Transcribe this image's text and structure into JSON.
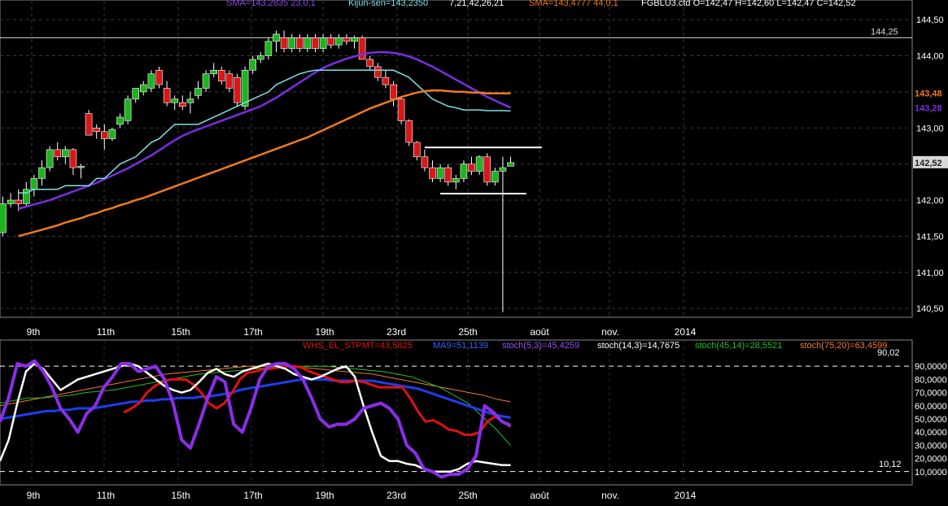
{
  "header": {
    "sma_short": "SMA=143,2835  23,0,1",
    "kijun": "Kijun-sen=143,2350",
    "ichimoku_params": "7,21,42,26,21",
    "sma_long": "SMA=143,4777  44,0,1",
    "ohlc": "FGBLU3.ctd O=142,47 H=142,60 L=142,47 C=142,52"
  },
  "price_axis": {
    "ticks": [
      "144,50",
      "144,00",
      "143,50",
      "143,00",
      "142,50",
      "142,00",
      "141,50",
      "141,00",
      "140,50"
    ],
    "markers": {
      "resistance": "144,25",
      "sma_long": "143,48",
      "sma_short": "143,28",
      "last": "142,52"
    }
  },
  "time_axis": {
    "labels": [
      "9th",
      "11th",
      "15th",
      "17th",
      "19th",
      "23rd",
      "25th",
      "août",
      "nov.",
      "2014"
    ]
  },
  "indicator_header": {
    "whs": "WHS_EL_STPMT=43,5825",
    "ma9": "MA9=51,1139",
    "stoch53": "stoch(5,3)=45,4259",
    "stoch143": "stoch(14,3)=14,7675",
    "stoch4514": "stoch(45,14)=28,5521",
    "stoch7520": "stoch(75,20)=63,4599"
  },
  "indicator_axis": {
    "ticks": [
      "90,0000",
      "80,0000",
      "70,0000",
      "60,0000",
      "50,0000",
      "40,0000",
      "30,0000",
      "20,0000",
      "10,0000"
    ],
    "upper_level": "90,02",
    "lower_level": "10,12"
  },
  "colors": {
    "background": "#000000",
    "up_candle": "#1fb31f",
    "down_candle": "#d81818",
    "sma_short": "#7a2ee0",
    "sma_long": "#f07a20",
    "kijun": "#7fe0e8",
    "whs": "#e01010",
    "ma9": "#1c3ff0",
    "stoch53": "#8a2ee8",
    "stoch143": "#ffffff",
    "stoch4514": "#22c022",
    "stoch7520": "#f07a30"
  },
  "chart_data": [
    {
      "type": "candlestick",
      "title": "FGBLU3.ctd",
      "ylim": [
        140.4,
        144.75
      ],
      "time_labels": [
        "9th",
        "11th",
        "15th",
        "17th",
        "19th",
        "23rd",
        "25th",
        "août",
        "nov.",
        "2014"
      ],
      "candles": [
        {
          "o": 141.55,
          "h": 142.05,
          "l": 141.5,
          "c": 141.95
        },
        {
          "o": 141.95,
          "h": 142.1,
          "l": 141.9,
          "c": 142.0
        },
        {
          "o": 142.0,
          "h": 142.15,
          "l": 141.85,
          "c": 141.95
        },
        {
          "o": 141.95,
          "h": 142.25,
          "l": 141.9,
          "c": 142.15
        },
        {
          "o": 142.15,
          "h": 142.35,
          "l": 142.05,
          "c": 142.3
        },
        {
          "o": 142.3,
          "h": 142.55,
          "l": 142.2,
          "c": 142.45
        },
        {
          "o": 142.45,
          "h": 142.75,
          "l": 142.4,
          "c": 142.7
        },
        {
          "o": 142.7,
          "h": 142.8,
          "l": 142.55,
          "c": 142.6
        },
        {
          "o": 142.6,
          "h": 142.75,
          "l": 142.5,
          "c": 142.7
        },
        {
          "o": 142.7,
          "h": 142.72,
          "l": 142.35,
          "c": 142.45
        },
        {
          "o": 142.45,
          "h": 142.5,
          "l": 142.3,
          "c": 142.47
        },
        {
          "o": 143.2,
          "h": 143.25,
          "l": 142.9,
          "c": 142.9
        },
        {
          "o": 143.0,
          "h": 143.05,
          "l": 142.85,
          "c": 142.95
        },
        {
          "o": 142.95,
          "h": 143.05,
          "l": 142.7,
          "c": 142.85
        },
        {
          "o": 142.85,
          "h": 143.0,
          "l": 142.82,
          "c": 142.98
        },
        {
          "o": 143.05,
          "h": 143.2,
          "l": 143.0,
          "c": 143.15
        },
        {
          "o": 143.1,
          "h": 143.45,
          "l": 143.05,
          "c": 143.4
        },
        {
          "o": 143.4,
          "h": 143.55,
          "l": 143.35,
          "c": 143.55
        },
        {
          "o": 143.5,
          "h": 143.65,
          "l": 143.45,
          "c": 143.6
        },
        {
          "o": 143.55,
          "h": 143.8,
          "l": 143.5,
          "c": 143.75
        },
        {
          "o": 143.8,
          "h": 143.85,
          "l": 143.55,
          "c": 143.6
        },
        {
          "o": 143.55,
          "h": 143.65,
          "l": 143.3,
          "c": 143.35
        },
        {
          "o": 143.35,
          "h": 143.45,
          "l": 143.25,
          "c": 143.4
        },
        {
          "o": 143.35,
          "h": 143.45,
          "l": 143.25,
          "c": 143.3
        },
        {
          "o": 143.35,
          "h": 143.5,
          "l": 143.2,
          "c": 143.4
        },
        {
          "o": 143.45,
          "h": 143.65,
          "l": 143.4,
          "c": 143.55
        },
        {
          "o": 143.55,
          "h": 143.8,
          "l": 143.5,
          "c": 143.75
        },
        {
          "o": 143.75,
          "h": 143.9,
          "l": 143.7,
          "c": 143.8
        },
        {
          "o": 143.8,
          "h": 143.85,
          "l": 143.6,
          "c": 143.65
        },
        {
          "o": 143.75,
          "h": 143.8,
          "l": 143.5,
          "c": 143.55
        },
        {
          "o": 143.7,
          "h": 143.75,
          "l": 143.3,
          "c": 143.35
        },
        {
          "o": 143.3,
          "h": 143.85,
          "l": 143.25,
          "c": 143.8
        },
        {
          "o": 143.8,
          "h": 144.0,
          "l": 143.75,
          "c": 143.95
        },
        {
          "o": 143.95,
          "h": 144.05,
          "l": 143.9,
          "c": 144.0
        },
        {
          "o": 144.0,
          "h": 144.25,
          "l": 143.95,
          "c": 144.2
        },
        {
          "o": 144.2,
          "h": 144.35,
          "l": 144.05,
          "c": 144.3
        },
        {
          "o": 144.25,
          "h": 144.35,
          "l": 144.05,
          "c": 144.1
        },
        {
          "o": 144.1,
          "h": 144.3,
          "l": 144.05,
          "c": 144.25
        },
        {
          "o": 144.25,
          "h": 144.3,
          "l": 144.05,
          "c": 144.1
        },
        {
          "o": 144.1,
          "h": 144.3,
          "l": 144.05,
          "c": 144.25
        },
        {
          "o": 144.25,
          "h": 144.3,
          "l": 144.05,
          "c": 144.1
        },
        {
          "o": 144.1,
          "h": 144.3,
          "l": 144.05,
          "c": 144.25
        },
        {
          "o": 144.25,
          "h": 144.3,
          "l": 144.1,
          "c": 144.15
        },
        {
          "o": 144.15,
          "h": 144.3,
          "l": 144.1,
          "c": 144.25
        },
        {
          "o": 144.25,
          "h": 144.3,
          "l": 144.15,
          "c": 144.2
        },
        {
          "o": 144.2,
          "h": 144.28,
          "l": 144.1,
          "c": 144.25
        },
        {
          "o": 144.25,
          "h": 144.28,
          "l": 143.95,
          "c": 143.95
        },
        {
          "o": 143.95,
          "h": 144.0,
          "l": 143.8,
          "c": 143.85
        },
        {
          "o": 143.85,
          "h": 143.9,
          "l": 143.65,
          "c": 143.7
        },
        {
          "o": 143.7,
          "h": 143.8,
          "l": 143.55,
          "c": 143.6
        },
        {
          "o": 143.6,
          "h": 143.65,
          "l": 143.3,
          "c": 143.4
        },
        {
          "o": 143.4,
          "h": 143.42,
          "l": 143.05,
          "c": 143.1
        },
        {
          "o": 143.1,
          "h": 143.12,
          "l": 142.75,
          "c": 142.8
        },
        {
          "o": 142.8,
          "h": 142.82,
          "l": 142.55,
          "c": 142.6
        },
        {
          "o": 142.6,
          "h": 142.7,
          "l": 142.4,
          "c": 142.45
        },
        {
          "o": 142.45,
          "h": 142.55,
          "l": 142.25,
          "c": 142.3
        },
        {
          "o": 142.3,
          "h": 142.5,
          "l": 142.25,
          "c": 142.45
        },
        {
          "o": 142.45,
          "h": 142.5,
          "l": 142.2,
          "c": 142.25
        },
        {
          "o": 142.25,
          "h": 142.35,
          "l": 142.15,
          "c": 142.3
        },
        {
          "o": 142.3,
          "h": 142.55,
          "l": 142.25,
          "c": 142.5
        },
        {
          "o": 142.5,
          "h": 142.6,
          "l": 142.35,
          "c": 142.4
        },
        {
          "o": 142.4,
          "h": 142.62,
          "l": 142.35,
          "c": 142.6
        },
        {
          "o": 142.6,
          "h": 142.65,
          "l": 142.2,
          "c": 142.25
        },
        {
          "o": 142.25,
          "h": 142.45,
          "l": 142.2,
          "c": 142.4
        },
        {
          "o": 142.4,
          "h": 142.6,
          "l": 140.45,
          "c": 142.45
        },
        {
          "o": 142.47,
          "h": 142.6,
          "l": 142.47,
          "c": 142.52
        }
      ],
      "series": [
        {
          "name": "SMA=143,2835  23,0,1",
          "values": [
            141.88,
            141.91,
            141.94,
            141.97,
            142.0,
            142.04,
            142.08,
            142.12,
            142.16,
            142.2,
            142.24,
            142.29,
            142.34,
            142.39,
            142.44,
            142.5,
            142.56,
            142.62,
            142.69,
            142.76,
            142.83,
            142.89,
            142.94,
            142.98,
            143.02,
            143.06,
            143.1,
            143.14,
            143.18,
            143.22,
            143.26,
            143.3,
            143.36,
            143.42,
            143.49,
            143.56,
            143.63,
            143.7,
            143.77,
            143.83,
            143.88,
            143.92,
            143.96,
            143.99,
            144.02,
            144.04,
            144.05,
            144.05,
            144.04,
            144.02,
            143.99,
            143.95,
            143.9,
            143.85,
            143.79,
            143.73,
            143.67,
            143.61,
            143.55,
            143.49,
            143.43,
            143.38,
            143.33,
            143.28
          ]
        },
        {
          "name": "Kijun-sen=143,2350",
          "values": [
            142.1,
            142.1,
            142.15,
            142.15,
            142.15,
            142.15,
            142.2,
            142.2,
            142.2,
            142.2,
            142.3,
            142.3,
            142.4,
            142.5,
            142.55,
            142.6,
            142.7,
            142.8,
            142.85,
            142.95,
            143.05,
            143.05,
            143.05,
            143.05,
            143.1,
            143.15,
            143.2,
            143.25,
            143.3,
            143.35,
            143.4,
            143.45,
            143.5,
            143.6,
            143.65,
            143.7,
            143.75,
            143.78,
            143.8,
            143.8,
            143.8,
            143.8,
            143.8,
            143.8,
            143.8,
            143.8,
            143.8,
            143.8,
            143.8,
            143.75,
            143.7,
            143.6,
            143.5,
            143.4,
            143.35,
            143.3,
            143.28,
            143.25,
            143.25,
            143.25,
            143.24,
            143.24,
            143.24,
            143.235
          ]
        },
        {
          "name": "SMA=143,4777  44,0,1",
          "values": [
            141.5,
            141.53,
            141.56,
            141.59,
            141.62,
            141.65,
            141.69,
            141.72,
            141.75,
            141.79,
            141.82,
            141.86,
            141.89,
            141.93,
            141.96,
            142.0,
            142.03,
            142.07,
            142.11,
            142.15,
            142.19,
            142.23,
            142.27,
            142.31,
            142.35,
            142.39,
            142.43,
            142.47,
            142.51,
            142.55,
            142.59,
            142.63,
            142.67,
            142.71,
            142.75,
            142.79,
            142.83,
            142.87,
            142.92,
            142.97,
            143.02,
            143.07,
            143.12,
            143.17,
            143.22,
            143.27,
            143.31,
            143.35,
            143.39,
            143.43,
            143.46,
            143.49,
            143.51,
            143.52,
            143.52,
            143.51,
            143.5,
            143.5,
            143.49,
            143.49,
            143.48,
            143.48,
            143.48,
            143.48
          ]
        }
      ],
      "annotations": [
        {
          "type": "hline",
          "y": 144.25,
          "label": "144,25"
        },
        {
          "type": "segment",
          "y": 142.73,
          "from_index": 54,
          "to_index": 69
        },
        {
          "type": "segment",
          "y": 142.09,
          "from_index": 56,
          "to_index": 67
        }
      ]
    },
    {
      "type": "line",
      "title": "",
      "ylim": [
        0,
        100
      ],
      "levels": [
        90.02,
        10.12
      ],
      "series": [
        {
          "name": "WHS_EL_STPMT=43,5825",
          "values": [
            null,
            null,
            null,
            null,
            null,
            null,
            null,
            null,
            null,
            null,
            null,
            null,
            null,
            null,
            null,
            null,
            55,
            58,
            62,
            70,
            75,
            78,
            80,
            80,
            80,
            76,
            70,
            62,
            58,
            62,
            70,
            80,
            85,
            86,
            88,
            88,
            89,
            90,
            90,
            89,
            86,
            84,
            82,
            80,
            78,
            78,
            79,
            78,
            76,
            74,
            74,
            74,
            74,
            66,
            56,
            48,
            49,
            46,
            42,
            41,
            38,
            38,
            40,
            48,
            52,
            48,
            44
          ]
        },
        {
          "name": "MA9=51,1139",
          "values": [
            50,
            51,
            52,
            53,
            54,
            55,
            56,
            56,
            57,
            57,
            58,
            58,
            58,
            59,
            60,
            61,
            62,
            63,
            63,
            64,
            64,
            65,
            65,
            66,
            66,
            66,
            67,
            67,
            68,
            69,
            70,
            72,
            73,
            74,
            75,
            76,
            77,
            78,
            79,
            80,
            80,
            80,
            80,
            79,
            79,
            79,
            79,
            79,
            79,
            78,
            77,
            76,
            75,
            74,
            73,
            71,
            69,
            67,
            65,
            63,
            61,
            59,
            57,
            55,
            53,
            52,
            51
          ]
        },
        {
          "name": "stoch(5,3)=45,4259",
          "values": [
            48,
            66,
            92,
            90,
            94,
            86,
            74,
            58,
            50,
            40,
            54,
            60,
            74,
            82,
            92,
            92,
            86,
            88,
            90,
            80,
            62,
            34,
            28,
            46,
            66,
            82,
            78,
            46,
            40,
            58,
            80,
            90,
            92,
            92,
            88,
            80,
            66,
            50,
            44,
            46,
            46,
            50,
            58,
            60,
            62,
            58,
            50,
            30,
            24,
            12,
            10,
            6,
            8,
            8,
            12,
            22,
            60,
            55,
            48,
            45
          ]
        },
        {
          "name": "stoch(14,3)=14,7675",
          "values": [
            18,
            34,
            62,
            86,
            92,
            88,
            80,
            72,
            76,
            80,
            82,
            84,
            86,
            88,
            90,
            92,
            90,
            85,
            80,
            75,
            72,
            70,
            72,
            78,
            85,
            88,
            84,
            82,
            86,
            88,
            90,
            92,
            90,
            88,
            84,
            82,
            80,
            82,
            85,
            88,
            90,
            82,
            60,
            40,
            22,
            18,
            18,
            16,
            15,
            12,
            10,
            10,
            10,
            12,
            16,
            18,
            17,
            16,
            15,
            15
          ]
        },
        {
          "name": "stoch(45,14)=28,5521",
          "values": [
            62,
            64,
            66,
            66,
            67,
            68,
            70,
            71,
            72,
            74,
            76,
            78,
            80,
            82,
            84,
            85,
            86,
            87,
            88,
            89,
            90,
            90,
            90,
            90,
            89,
            88,
            87,
            86,
            84,
            82,
            78,
            74,
            68,
            62,
            52,
            42,
            30
          ]
        },
        {
          "name": "stoch(75,20)=63,4599",
          "values": [
            60,
            62,
            64,
            66,
            68,
            70,
            72,
            74,
            76,
            78,
            80,
            82,
            84,
            85,
            86,
            87,
            88,
            89,
            90,
            90,
            90,
            90,
            89,
            88,
            87,
            86,
            85,
            84,
            82,
            80,
            78,
            76,
            74,
            72,
            70,
            68,
            65,
            63
          ]
        }
      ]
    }
  ]
}
